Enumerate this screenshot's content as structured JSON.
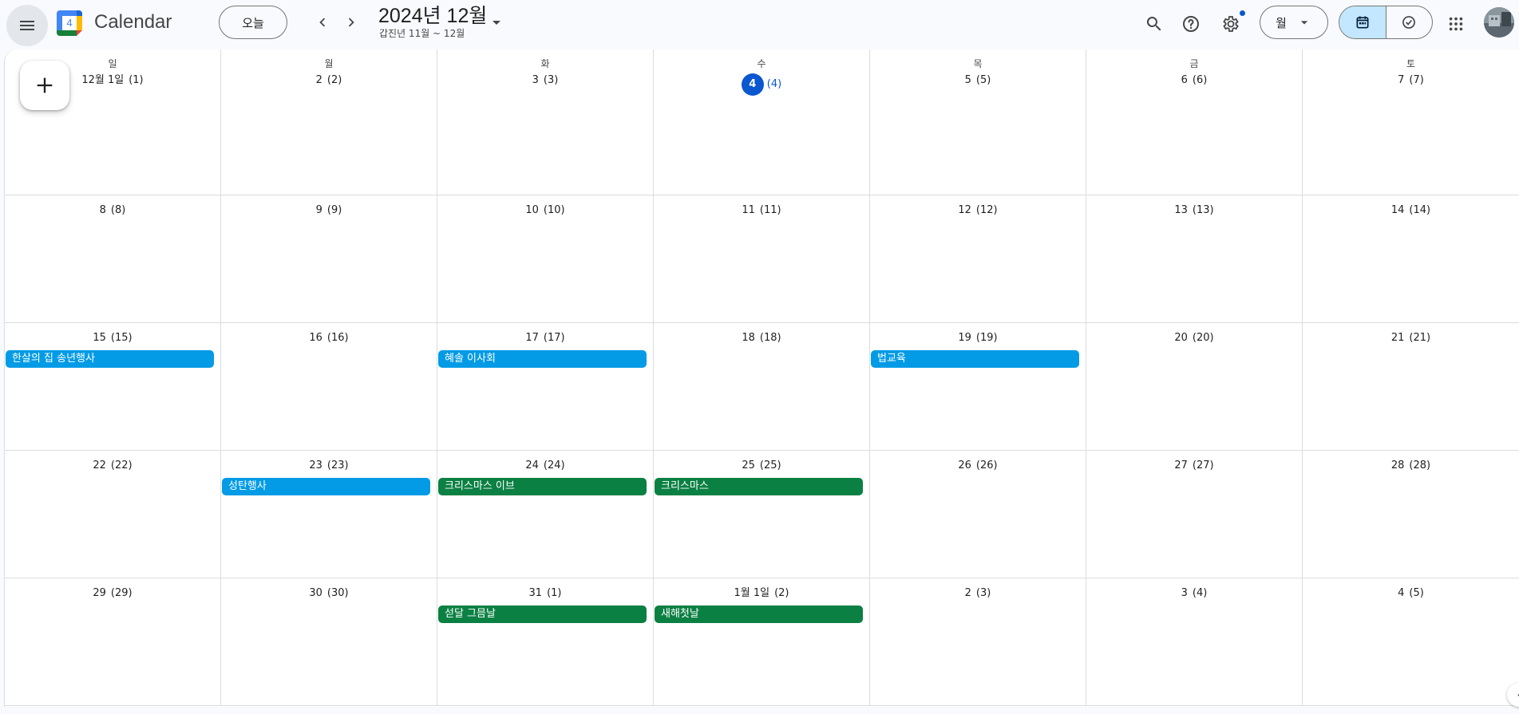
{
  "header": {
    "app_title": "Calendar",
    "logo_day": "4",
    "today_label": "오늘",
    "period_title": "2024년 12월",
    "period_subtitle": "갑진년 11월 ~ 12월",
    "view_label": "월"
  },
  "icons": {
    "menu": "menu-icon",
    "prev": "chevron-left-icon",
    "next": "chevron-right-icon",
    "search": "search-icon",
    "help": "help-icon",
    "settings": "gear-icon",
    "calendar_view": "calendar-icon",
    "tasks_view": "check-circle-icon",
    "apps": "apps-grid-icon",
    "create": "plus-icon"
  },
  "colors": {
    "event_blue": "#039be5",
    "event_green": "#0b8043",
    "today": "#0b57d0",
    "selected_view": "#c2e7ff"
  },
  "weekdays": [
    "일",
    "월",
    "화",
    "수",
    "목",
    "금",
    "토"
  ],
  "weeks": [
    [
      {
        "num": "12월 1일",
        "lunar": "(1)"
      },
      {
        "num": "2",
        "lunar": "(2)"
      },
      {
        "num": "3",
        "lunar": "(3)"
      },
      {
        "num": "4",
        "lunar": "(4)",
        "today": true
      },
      {
        "num": "5",
        "lunar": "(5)"
      },
      {
        "num": "6",
        "lunar": "(6)"
      },
      {
        "num": "7",
        "lunar": "(7)"
      }
    ],
    [
      {
        "num": "8",
        "lunar": "(8)"
      },
      {
        "num": "9",
        "lunar": "(9)"
      },
      {
        "num": "10",
        "lunar": "(10)"
      },
      {
        "num": "11",
        "lunar": "(11)"
      },
      {
        "num": "12",
        "lunar": "(12)"
      },
      {
        "num": "13",
        "lunar": "(13)"
      },
      {
        "num": "14",
        "lunar": "(14)"
      }
    ],
    [
      {
        "num": "15",
        "lunar": "(15)",
        "event": {
          "title": "한살의 집 송년행사",
          "color": "blue"
        }
      },
      {
        "num": "16",
        "lunar": "(16)"
      },
      {
        "num": "17",
        "lunar": "(17)",
        "event": {
          "title": "혜솔 이사회",
          "color": "blue"
        }
      },
      {
        "num": "18",
        "lunar": "(18)"
      },
      {
        "num": "19",
        "lunar": "(19)",
        "event": {
          "title": "법교육",
          "color": "blue"
        }
      },
      {
        "num": "20",
        "lunar": "(20)"
      },
      {
        "num": "21",
        "lunar": "(21)"
      }
    ],
    [
      {
        "num": "22",
        "lunar": "(22)"
      },
      {
        "num": "23",
        "lunar": "(23)",
        "event": {
          "title": "성탄행사",
          "color": "blue"
        }
      },
      {
        "num": "24",
        "lunar": "(24)",
        "event": {
          "title": "크리스마스 이브",
          "color": "green"
        }
      },
      {
        "num": "25",
        "lunar": "(25)",
        "event": {
          "title": "크리스마스",
          "color": "green"
        }
      },
      {
        "num": "26",
        "lunar": "(26)"
      },
      {
        "num": "27",
        "lunar": "(27)"
      },
      {
        "num": "28",
        "lunar": "(28)"
      }
    ],
    [
      {
        "num": "29",
        "lunar": "(29)"
      },
      {
        "num": "30",
        "lunar": "(30)"
      },
      {
        "num": "31",
        "lunar": "(1)",
        "event": {
          "title": "섣달 그믐날",
          "color": "green"
        }
      },
      {
        "num": "1월 1일",
        "lunar": "(2)",
        "event": {
          "title": "새해첫날",
          "color": "green"
        }
      },
      {
        "num": "2",
        "lunar": "(3)"
      },
      {
        "num": "3",
        "lunar": "(4)"
      },
      {
        "num": "4",
        "lunar": "(5)"
      }
    ]
  ]
}
